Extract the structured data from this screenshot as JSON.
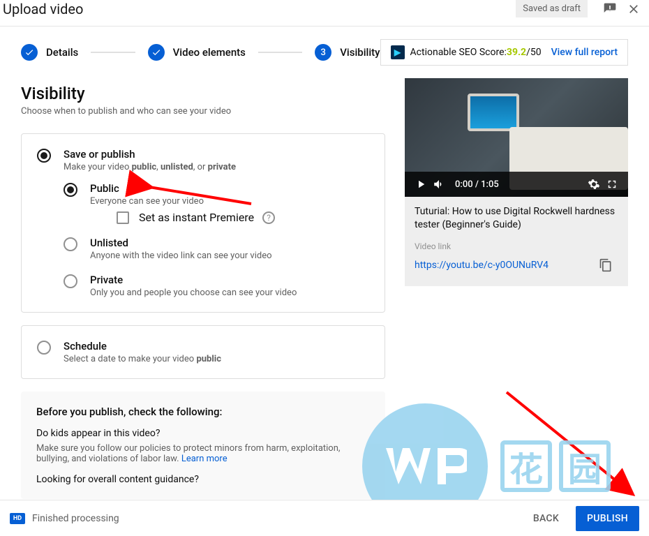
{
  "title": "Upload video",
  "draft_badge": "Saved as draft",
  "steps": [
    "Details",
    "Video elements",
    "Visibility"
  ],
  "seo": {
    "text": "Actionable SEO Score: ",
    "score": "39.2",
    "max": "/50",
    "link": "View full report"
  },
  "visibility": {
    "heading": "Visibility",
    "sub": "Choose when to publish and who can see your video",
    "save_publish": {
      "title": "Save or publish",
      "desc_pre": "Make your video ",
      "public": "public",
      "unlisted": "unlisted",
      "private": "private",
      "sep1": ", ",
      "sep2": ", or "
    },
    "opts": {
      "public": {
        "title": "Public",
        "desc": "Everyone can see your video",
        "premiere": "Set as instant Premiere"
      },
      "unlisted": {
        "title": "Unlisted",
        "desc": "Anyone with the video link can see your video"
      },
      "private": {
        "title": "Private",
        "desc": "Only you and people you choose can see your video"
      }
    },
    "schedule": {
      "title": "Schedule",
      "desc_pre": "Select a date to make your video ",
      "bold": "public"
    }
  },
  "before": {
    "heading": "Before you publish, check the following:",
    "q1": "Do kids appear in this video?",
    "q1desc": "Make sure you follow our policies to protect minors from harm, exploitation, bullying, and violations of labor law. ",
    "learn": "Learn more",
    "q2": "Looking for overall content guidance?"
  },
  "preview": {
    "time": "0:00 / 1:05",
    "title": "Tuturial: How to use Digital Rockwell hardness tester (Beginner's Guide)",
    "link_label": "Video link",
    "link": "https://youtu.be/c-y0OUNuRV4"
  },
  "footer": {
    "hd": "HD",
    "status": "Finished processing",
    "back": "BACK",
    "publish": "PUBLISH"
  },
  "watermark": {
    "c1": "花",
    "c2": "园"
  }
}
